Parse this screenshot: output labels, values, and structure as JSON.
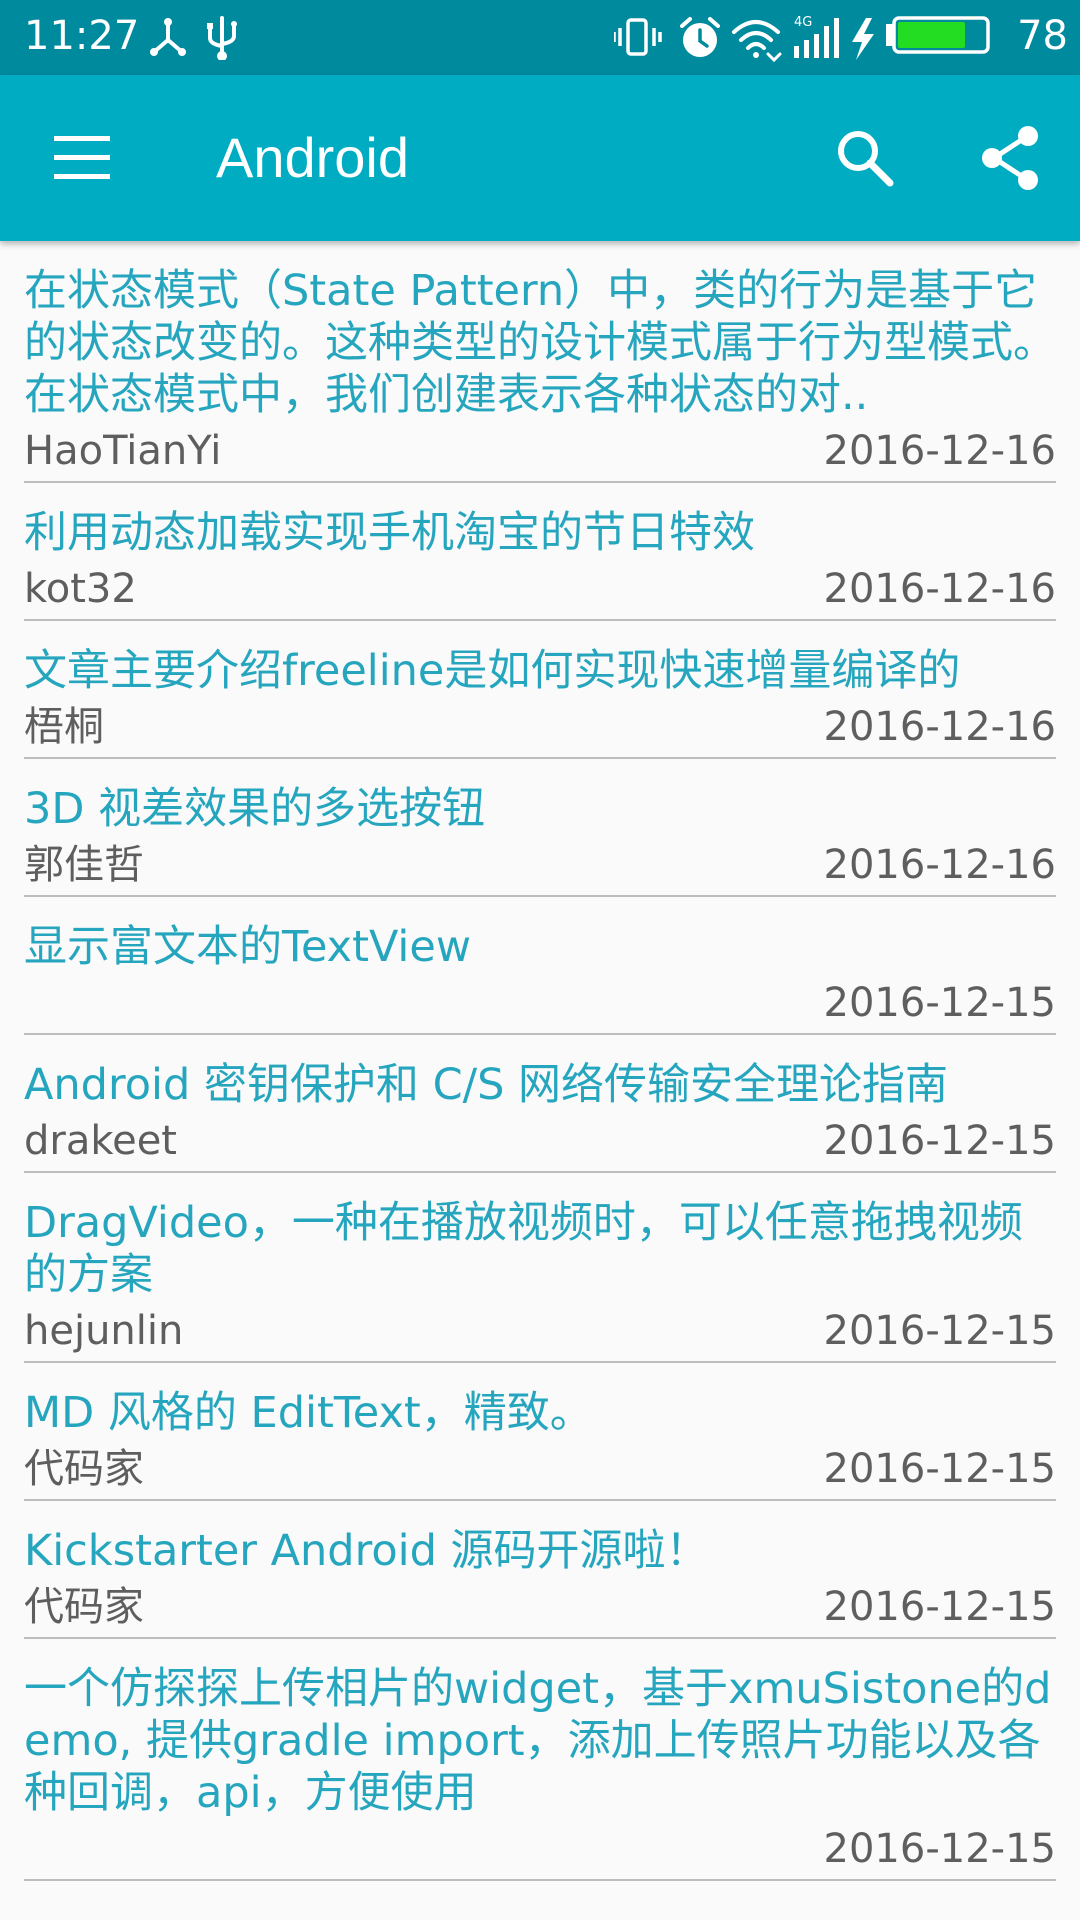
{
  "status_bar": {
    "time": "11:27",
    "battery_percent": "78",
    "bar_color": "#008A9E",
    "battery_level": 0.78,
    "icons": [
      "network-share-icon",
      "usb-icon",
      "vibrate-icon",
      "alarm-icon",
      "wifi-icon",
      "signal-4g-icon",
      "charging-icon",
      "battery-icon"
    ]
  },
  "app_bar": {
    "title": "Android",
    "color": "#00ACC1",
    "icons": [
      "menu-icon",
      "search-icon",
      "share-icon"
    ]
  },
  "colors": {
    "title_text": "#26A6BE",
    "meta_text": "#5E5E5E",
    "divider": "#BDBDBD",
    "background": "#FAFAFA"
  },
  "articles": [
    {
      "title": "在状态模式（State Pattern）中，类的行为是基于它的状态改变的。这种类型的设计模式属于行为型模式。在状态模式中，我们创建表示各种状态的对..",
      "author": "HaoTianYi",
      "date": "2016-12-16"
    },
    {
      "title": "利用动态加载实现手机淘宝的节日特效",
      "author": "kot32",
      "date": "2016-12-16"
    },
    {
      "title": "文章主要介绍freeline是如何实现快速增量编译的",
      "author": "梧桐",
      "date": "2016-12-16"
    },
    {
      "title": "3D 视差效果的多选按钮",
      "author": "郭佳哲",
      "date": "2016-12-16"
    },
    {
      "title": "显示富文本的TextView",
      "author": "",
      "date": "2016-12-15"
    },
    {
      "title": "Android 密钥保护和 C/S 网络传输安全理论指南",
      "author": "drakeet",
      "date": "2016-12-15"
    },
    {
      "title": "DragVideo，一种在播放视频时，可以任意拖拽视频的方案",
      "author": "hejunlin",
      "date": "2016-12-15"
    },
    {
      "title": "MD 风格的 EditText，精致。",
      "author": "代码家",
      "date": "2016-12-15"
    },
    {
      "title": "Kickstarter Android 源码开源啦！",
      "author": "代码家",
      "date": "2016-12-15"
    },
    {
      "title": "一个仿探探上传相片的widget，基于xmuSistone的demo, 提供gradle import，添加上传照片功能以及各种回调，api，方便使用",
      "author": "",
      "date": "2016-12-15"
    }
  ]
}
